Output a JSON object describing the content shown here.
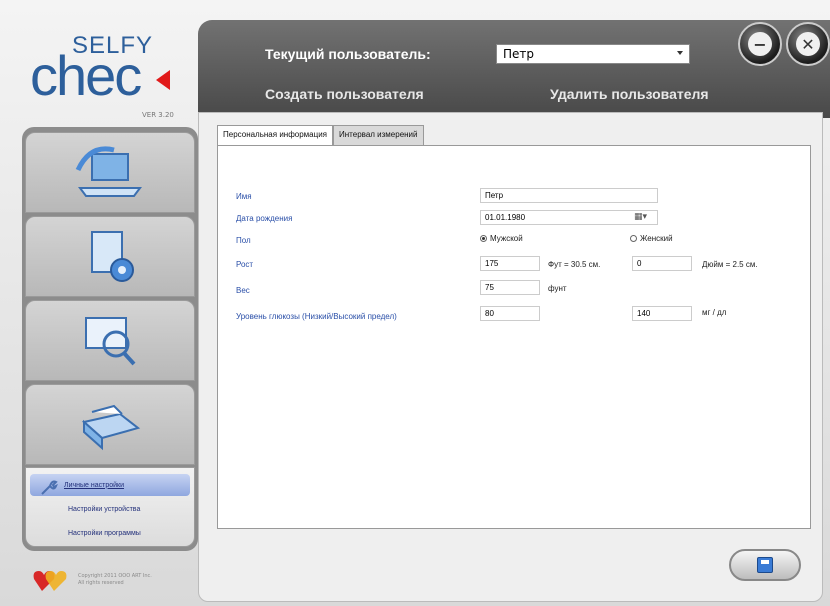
{
  "logo": {
    "top": "SELFY",
    "main": "chec",
    "version": "VER 3.20"
  },
  "header": {
    "current_user_label": "Текущий пользователь:",
    "current_user_value": "Петр",
    "create_user": "Создать пользователя",
    "delete_user": "Удалить пользователя"
  },
  "window_controls": {
    "minimize_glyph": "−",
    "close_glyph": "✕"
  },
  "sidebar": {
    "buttons": [
      {
        "icon": "laptop-icon"
      },
      {
        "icon": "document-settings-icon"
      },
      {
        "icon": "search-chart-icon"
      },
      {
        "icon": "printer-icon"
      }
    ],
    "submenu": [
      {
        "label": "Личные настройки",
        "active": true
      },
      {
        "label": "Настройки устройства",
        "active": false
      },
      {
        "label": "Настройки программы",
        "active": false
      }
    ]
  },
  "copyright": {
    "line1": "Copyright 2011 OOO ART Inc.",
    "line2": "All rights reserved"
  },
  "tabs": [
    {
      "label": "Персональная информация",
      "active": true
    },
    {
      "label": "Интервал измерений",
      "active": false
    }
  ],
  "form": {
    "name_label": "Имя",
    "name_value": "Петр",
    "dob_label": "Дата рождения",
    "dob_value": "01.01.1980",
    "dob_picker": "▦▾",
    "sex_label": "Пол",
    "sex_male": "Мужской",
    "sex_female": "Женский",
    "height_label": "Рост",
    "height_ft": "175",
    "height_ft_note": "Фут = 30.5 см.",
    "height_in": "0",
    "height_in_note": "Дюйм = 2.5 см.",
    "weight_label": "Вес",
    "weight_value": "75",
    "weight_unit": "фунт",
    "glucose_label": "Уровень глюкозы (Низкий/Высокий предел)",
    "glucose_low": "80",
    "glucose_high": "140",
    "glucose_unit": "мг / дл"
  }
}
